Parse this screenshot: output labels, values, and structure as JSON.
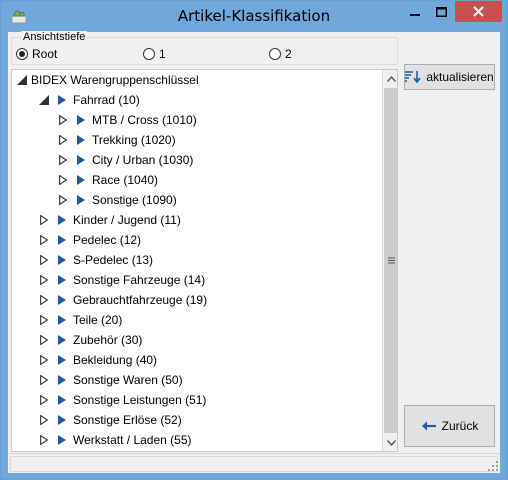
{
  "window": {
    "title": "Artikel-Klassifikation"
  },
  "depth_group": {
    "label": "Ansichtstiefe",
    "options": [
      {
        "label": "Root",
        "selected": true
      },
      {
        "label": "1",
        "selected": false
      },
      {
        "label": "2",
        "selected": false
      }
    ]
  },
  "tree": {
    "root": "BIDEX Warengruppenschlüssel",
    "fahrrad": "Fahrrad (10)",
    "fahrrad_children": [
      "MTB / Cross (1010)",
      "Trekking (1020)",
      "City / Urban (1030)",
      "Race (1040)",
      "Sonstige (1090)"
    ],
    "groups": [
      "Kinder / Jugend (11)",
      "Pedelec (12)",
      "S-Pedelec (13)",
      "Sonstige Fahrzeuge (14)",
      "Gebrauchtfahrzeuge (19)",
      "Teile (20)",
      "Zubehör (30)",
      "Bekleidung (40)",
      "Sonstige Waren (50)",
      "Sonstige Leistungen (51)",
      "Sonstige Erlöse (52)",
      "Werkstatt / Laden (55)"
    ]
  },
  "buttons": {
    "refresh": "aktualisieren",
    "back": "Zurück"
  },
  "status": {
    "text": ""
  },
  "colors": {
    "titlebar": "#6fa8dc",
    "close": "#c75050",
    "node_arrow": "#1e5aa8"
  },
  "icons": {
    "app": "app-icon",
    "minimize": "minimize-icon",
    "maximize": "maximize-icon",
    "close": "close-icon",
    "refresh": "sort-refresh-icon",
    "back": "arrow-left-icon"
  }
}
